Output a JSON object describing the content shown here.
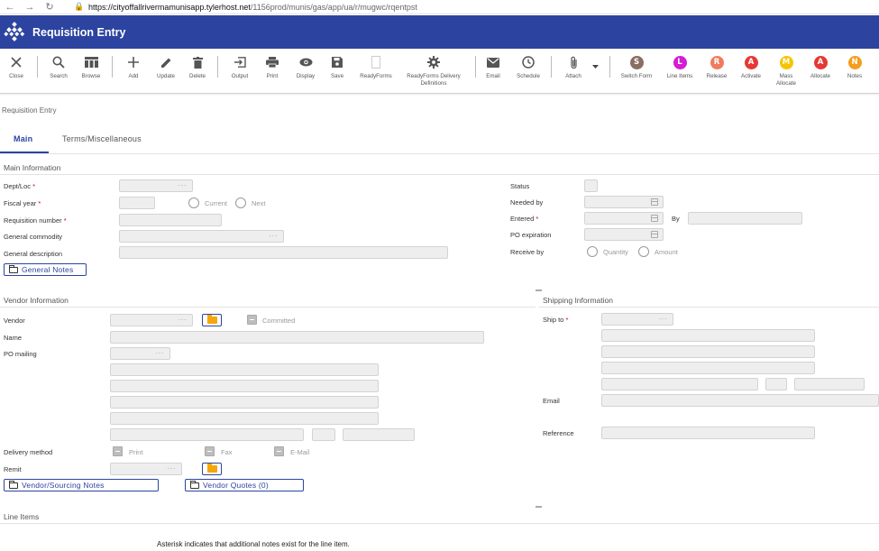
{
  "browser": {
    "url_host": "https://cityoffallrivermamunisapp.tylerhost.net",
    "url_path": "/1156prod/munis/gas/app/ua/r/mugwc/rqentpst"
  },
  "app": {
    "title": "Requisition Entry"
  },
  "toolbar": {
    "close": "Close",
    "search": "Search",
    "browse": "Browse",
    "add": "Add",
    "update": "Update",
    "delete": "Delete",
    "output": "Output",
    "print": "Print",
    "display": "Display",
    "save": "Save",
    "readyforms": "ReadyForms",
    "readyforms_delivery": "ReadyForms Delivery Definitions",
    "email": "Email",
    "schedule": "Schedule",
    "attach": "Attach",
    "switch_form": "Switch Form",
    "line_items": "Line Items",
    "release": "Release",
    "activate": "Activate",
    "mass_allocate": "Mass Allocate",
    "allocate": "Allocate",
    "notes": "Notes",
    "circles": {
      "switch_form": {
        "letter": "S",
        "color": "#8a6d63"
      },
      "line_items": {
        "letter": "L",
        "color": "#d41dd4"
      },
      "release": {
        "letter": "R",
        "color": "#f07b5e"
      },
      "activate": {
        "letter": "A",
        "color": "#e53935"
      },
      "mass_allocate": {
        "letter": "M",
        "color": "#f5c400"
      },
      "allocate": {
        "letter": "A",
        "color": "#e53935"
      },
      "notes": {
        "letter": "N",
        "color": "#f59d1e"
      }
    }
  },
  "breadcrumb": "Requisition Entry",
  "tabs": {
    "main": "Main",
    "terms": "Terms/Miscellaneous"
  },
  "main_info": {
    "title": "Main Information",
    "dept_loc": "Dept/Loc",
    "fiscal_year": "Fiscal year",
    "current": "Current",
    "next": "Next",
    "requisition_number": "Requisition number",
    "general_commodity": "General commodity",
    "general_description": "General description",
    "general_notes": "General Notes",
    "status": "Status",
    "needed_by": "Needed by",
    "entered": "Entered",
    "by": "By",
    "po_expiration": "PO expiration",
    "receive_by": "Receive by",
    "quantity": "Quantity",
    "amount": "Amount",
    "dots": "···"
  },
  "vendor_info": {
    "title": "Vendor Information",
    "vendor": "Vendor",
    "committed": "Committed",
    "name": "Name",
    "po_mailing": "PO mailing",
    "delivery_method": "Delivery method",
    "print": "Print",
    "fax": "Fax",
    "email": "E-Mail",
    "remit": "Remit",
    "vendor_notes": "Vendor/Sourcing Notes",
    "vendor_quotes": "Vendor Quotes (0)"
  },
  "shipping_info": {
    "title": "Shipping Information",
    "ship_to": "Ship to",
    "email": "Email",
    "reference": "Reference"
  },
  "line_items": {
    "title": "Line Items",
    "footnote": "Asterisk indicates that additional notes exist for the line item."
  },
  "required_mark": "*"
}
